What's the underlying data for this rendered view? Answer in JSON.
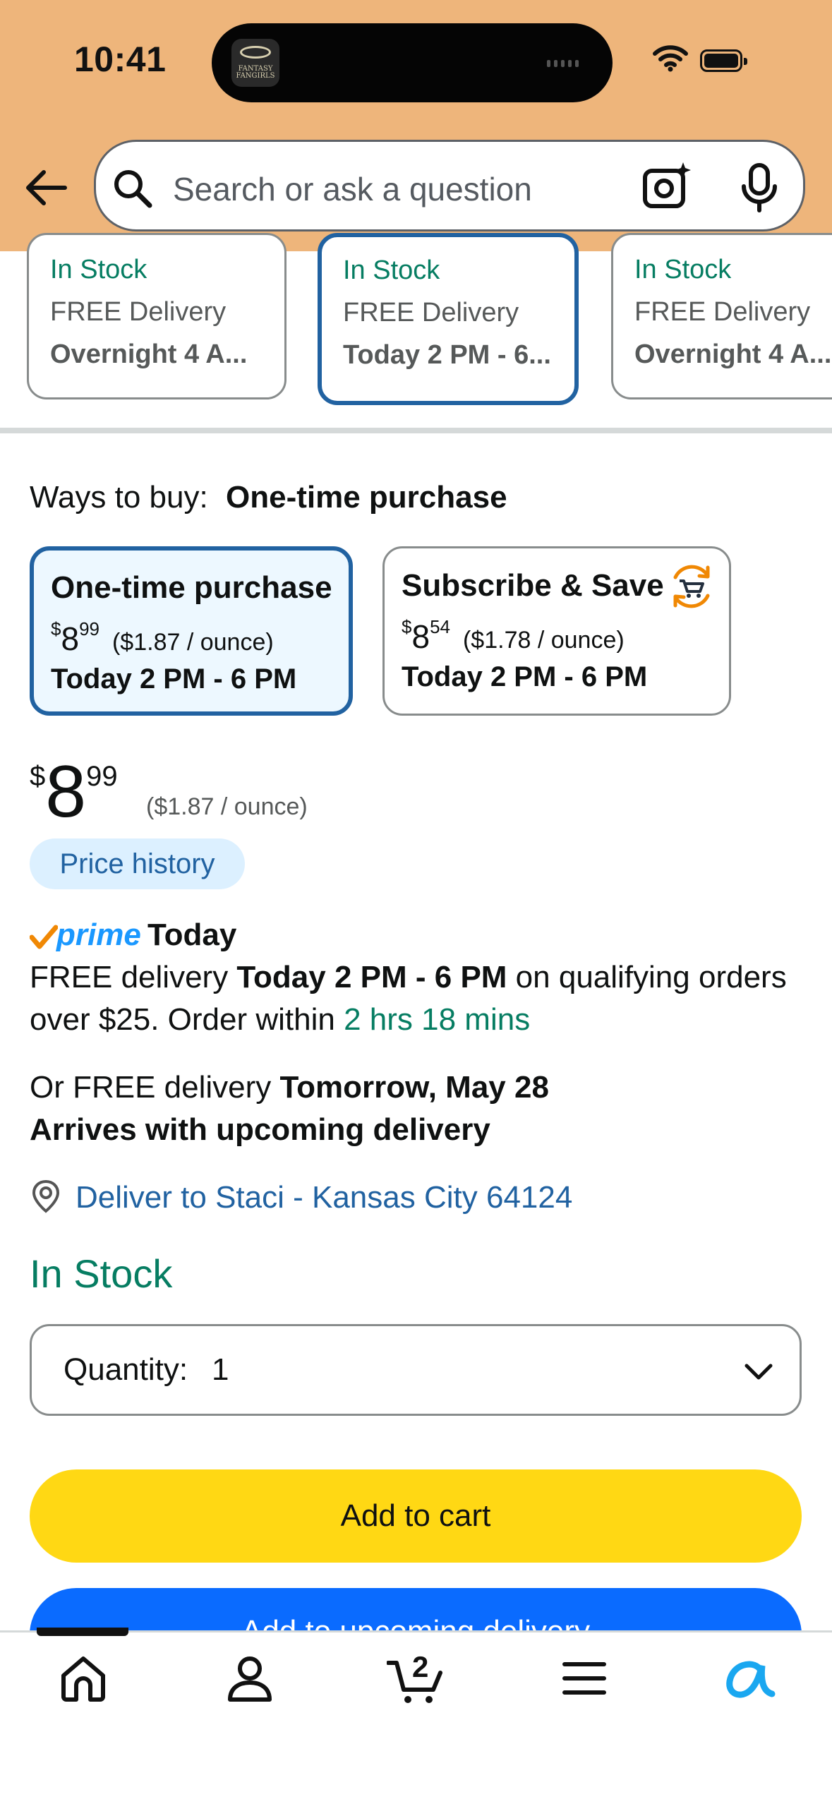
{
  "status_bar": {
    "time": "10:41",
    "island_app_name": "FANTASY FANGIRLS"
  },
  "header": {
    "search": {
      "placeholder": "Search or ask a question",
      "value": ""
    },
    "icons": [
      "back-arrow-icon",
      "search-icon",
      "camera-lens-icon",
      "microphone-icon"
    ]
  },
  "delivery_options": [
    {
      "stock": "In Stock",
      "delivery": "FREE Delivery",
      "window": "Overnight 4 A...",
      "selected": false
    },
    {
      "stock": "In Stock",
      "delivery": "FREE Delivery",
      "window": "Today 2 PM - 6...",
      "selected": true
    },
    {
      "stock": "In Stock",
      "delivery": "FREE Delivery",
      "window": "Overnight 4 A...",
      "selected": false
    }
  ],
  "ways_to_buy": {
    "label": "Ways to buy:",
    "selected": "One-time purchase",
    "options": [
      {
        "title": "One-time purchase",
        "currency": "$",
        "price_whole": "8",
        "price_fraction": "99",
        "unit_price": "($1.87 / ounce)",
        "delivery": "Today 2 PM - 6 PM",
        "selected": true
      },
      {
        "title": "Subscribe & Save",
        "currency": "$",
        "price_whole": "8",
        "price_fraction": "54",
        "unit_price": "($1.78 / ounce)",
        "delivery": "Today 2 PM - 6 PM",
        "selected": false
      }
    ]
  },
  "price": {
    "currency": "$",
    "whole": "8",
    "fraction": "99",
    "unit_price": "($1.87 / ounce)",
    "history_button": "Price history"
  },
  "prime_delivery": {
    "brand": "prime",
    "badge": "Today",
    "line1_prefix": "FREE delivery ",
    "line1_bold": "Today 2 PM - 6 PM",
    "line1_suffix": " on qualifying orders",
    "line2_prefix": "over $25. Order within ",
    "countdown": "2 hrs 18 mins",
    "alt_prefix": "Or FREE delivery ",
    "alt_bold": "Tomorrow, May 28",
    "alt_line2": "Arrives with upcoming delivery"
  },
  "location": {
    "text": "Deliver to Staci - Kansas City 64124"
  },
  "availability": "In Stock",
  "quantity": {
    "label": "Quantity:",
    "value": "1"
  },
  "actions": {
    "add_to_cart": "Add to cart",
    "add_to_upcoming": "Add to upcoming delivery"
  },
  "bottom_nav": {
    "items": [
      "home-icon",
      "account-icon",
      "cart-icon",
      "menu-icon",
      "rufus-ai-icon"
    ],
    "cart_count": "2"
  },
  "colors": {
    "header_bg": "#eeb57b",
    "accent_blue": "#2162a1",
    "stock_green": "#067d62",
    "cart_yellow": "#ffd814",
    "primary_blue": "#0a6bff"
  }
}
